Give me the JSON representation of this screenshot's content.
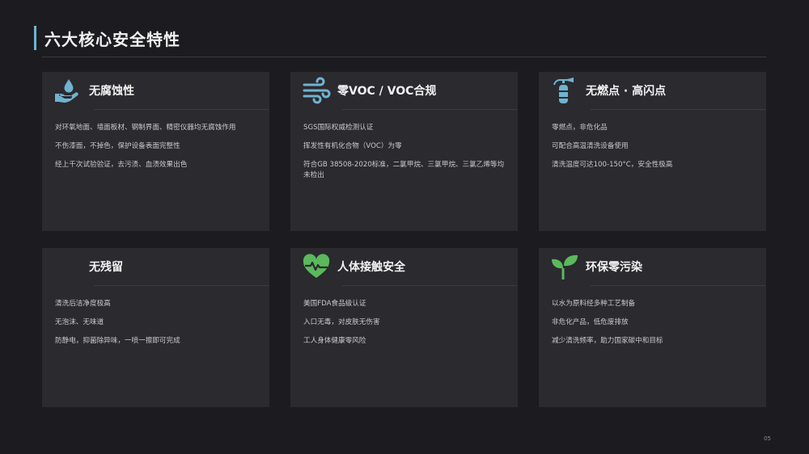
{
  "page": {
    "title": "六大核心安全特性",
    "page_number": "05",
    "accent": "#6fb3cf",
    "icon_blue": "#6fb3cf",
    "icon_green": "#5cb85c"
  },
  "cards": [
    {
      "icon": "hand-water-drop-icon",
      "title": "无腐蚀性",
      "items": [
        "对环氧地面、墙面板材、钢制界面、精密仪器均无腐蚀作用",
        "不伤漆面，不掉色，保护设备表面完整性",
        "经上千次试验验证，去污渍、血渍效果出色"
      ]
    },
    {
      "icon": "wind-icon",
      "title": "零VOC / VOC合规",
      "items": [
        "SGS国际权威检测认证",
        "挥发性有机化合物（VOC）为零",
        "符合GB 38508-2020标准，二氯甲烷、三氯甲烷、三氯乙烯等均未检出"
      ]
    },
    {
      "icon": "fire-extinguisher-icon",
      "title": "无燃点 · 高闪点",
      "items": [
        "零燃点，非危化品",
        "可配合高温清洗设备使用",
        "清洗温度可达100-150°C，安全性极高"
      ]
    },
    {
      "icon": "",
      "title": "无残留",
      "items": [
        "清洗后洁净度极高",
        "无泡沫、无味道",
        "防静电，抑菌除异味，一喷一擦即可完成"
      ]
    },
    {
      "icon": "heart-pulse-icon",
      "title": "人体接触安全",
      "items": [
        "美国FDA食品级认证",
        "入口无毒，对皮肤无伤害",
        "工人身体健康零风险"
      ]
    },
    {
      "icon": "sprout-icon",
      "title": "环保零污染",
      "items": [
        "以水为原料经多种工艺制备",
        "非危化产品，低危废排放",
        "减少清洗频率，助力国家碳中和目标"
      ]
    }
  ]
}
